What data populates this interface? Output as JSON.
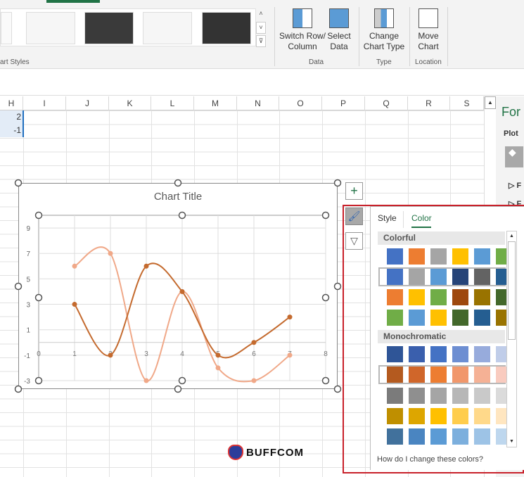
{
  "ribbon": {
    "group_chart_styles": "art Styles",
    "buttons": {
      "switch": "Switch Row/\nColumn",
      "switch_l1": "Switch Row/",
      "switch_l2": "Column",
      "select_l1": "Select",
      "select_l2": "Data",
      "change_l1": "Change",
      "change_l2": "Chart Type",
      "move_l1": "Move",
      "move_l2": "Chart"
    },
    "groups": {
      "data": "Data",
      "type": "Type",
      "location": "Location"
    }
  },
  "columns": [
    "H",
    "I",
    "J",
    "K",
    "L",
    "M",
    "N",
    "O",
    "P",
    "Q",
    "R",
    "S"
  ],
  "cells": {
    "h2": "2",
    "h3": "-1"
  },
  "chart_data": {
    "type": "line",
    "smoothed": true,
    "title": "Chart Title",
    "x": [
      1,
      2,
      3,
      4,
      5,
      6,
      7
    ],
    "xlim": [
      0,
      8
    ],
    "xticks": [
      "0",
      "1",
      "2",
      "3",
      "4",
      "5",
      "6",
      "7",
      "8"
    ],
    "ylim": [
      -3,
      10
    ],
    "yticks": [
      "9",
      "7",
      "5",
      "3",
      "1",
      "-1",
      "-3"
    ],
    "grid": true,
    "series": [
      {
        "values": [
          3,
          -1,
          6,
          4,
          -1,
          0,
          2
        ],
        "color": "#c46a2e"
      },
      {
        "values": [
          6,
          7,
          -3,
          4,
          -2,
          -3,
          -1
        ],
        "color": "#f0a888"
      }
    ]
  },
  "flyout": {
    "tab_style": "Style",
    "tab_color": "Color",
    "active_tab": "Color",
    "colorful_label": "Colorful",
    "mono_label": "Monochromatic",
    "help_link": "How do I change these colors?",
    "colorful": [
      [
        "#4472c4",
        "#ed7d31",
        "#a5a5a5",
        "#ffc000",
        "#5b9bd5",
        "#70ad47"
      ],
      [
        "#4472c4",
        "#a5a5a5",
        "#5b9bd5",
        "#264478",
        "#636363",
        "#255e91"
      ],
      [
        "#ed7d31",
        "#ffc000",
        "#70ad47",
        "#9e480e",
        "#997300",
        "#43682b"
      ],
      [
        "#70ad47",
        "#5b9bd5",
        "#ffc000",
        "#43682b",
        "#255e91",
        "#997300"
      ]
    ],
    "mono": [
      [
        "#2f5597",
        "#3a5fad",
        "#4472c4",
        "#6d8ed2",
        "#97abdc",
        "#c0cde9"
      ],
      [
        "#b45a1f",
        "#d0662a",
        "#ed7d31",
        "#f1976b",
        "#f5b195",
        "#f9cbbf"
      ],
      [
        "#7b7b7b",
        "#8f8f8f",
        "#a5a5a5",
        "#b7b7b7",
        "#c9c9c9",
        "#dbdbdb"
      ],
      [
        "#bf8f00",
        "#dda600",
        "#ffc000",
        "#ffcd4d",
        "#ffd98a",
        "#ffe6c0"
      ],
      [
        "#41719c",
        "#4a85c1",
        "#5b9bd5",
        "#7cafdd",
        "#9dc3e6",
        "#bed7ee"
      ]
    ]
  },
  "format_pane": {
    "title": "For",
    "section": "Plot",
    "item1": "F",
    "item2": "F"
  },
  "watermark": "BUFFCOM"
}
